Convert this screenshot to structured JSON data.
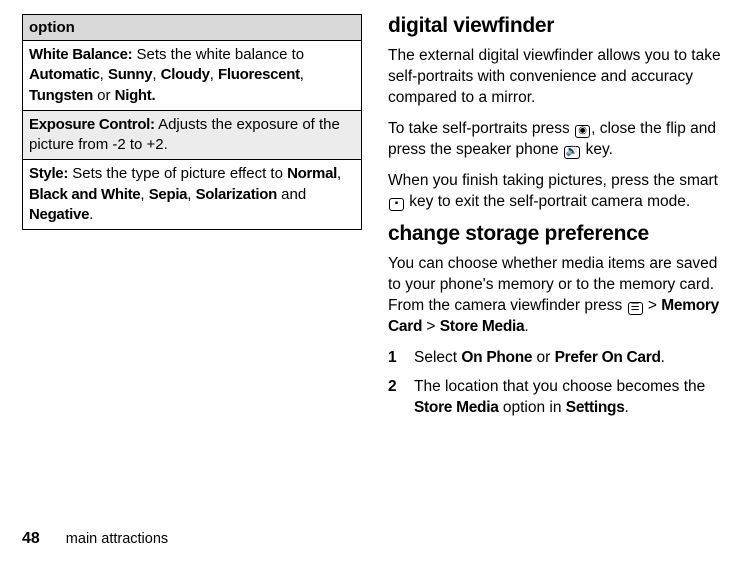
{
  "table": {
    "header": "option",
    "row1": {
      "label": "White Balance:",
      "desc": " Sets the white balance to ",
      "v1": "Automatic",
      "v2": "Sunny",
      "v3": "Cloudy",
      "v4": "Fluorescent",
      "v5": "Tungsten",
      "or": " or ",
      "v6": "Night.",
      "comma": ", "
    },
    "row2": {
      "label": "Exposure Control:",
      "desc": " Adjusts the exposure of the picture from -2 to +2."
    },
    "row3": {
      "label": "Style:",
      "desc": " Sets the type of picture effect to ",
      "v1": "Normal",
      "v2": "Black and White",
      "v3": "Sepia",
      "v4": "Solarization",
      "and": " and ",
      "v5": "Negative",
      "period": ".",
      "comma": ", "
    }
  },
  "digital": {
    "heading": "digital viewfinder",
    "p1": "The external digital viewfinder allows you to take self-portraits with convenience and accuracy compared to a mirror.",
    "p2a": "To take self-portraits press ",
    "icon1": "◉",
    "p2b": ", close the flip and press the speaker phone ",
    "icon2": "🔊",
    "p2c": " key.",
    "p3a": "When you finish taking pictures, press the smart ",
    "icon3": "▪",
    "p3b": " key to exit the self-portrait camera mode."
  },
  "storage": {
    "heading": "change storage preference",
    "p1a": "You can choose whether media items are saved to your phone's memory or to the memory card. From the camera viewfinder press ",
    "icon": "☰",
    "p1b": " > ",
    "m1": "Memory Card",
    "p1c": " > ",
    "m2": "Store Media",
    "period": ".",
    "step1": {
      "num": "1",
      "a": "Select ",
      "b": "On Phone",
      "c": " or ",
      "d": "Prefer On Card",
      "e": "."
    },
    "step2": {
      "num": "2",
      "a": "The location that you choose becomes the ",
      "b": "Store Media",
      "c": " option in ",
      "d": "Settings",
      "e": "."
    }
  },
  "footer": {
    "page": "48",
    "section": "main attractions"
  }
}
